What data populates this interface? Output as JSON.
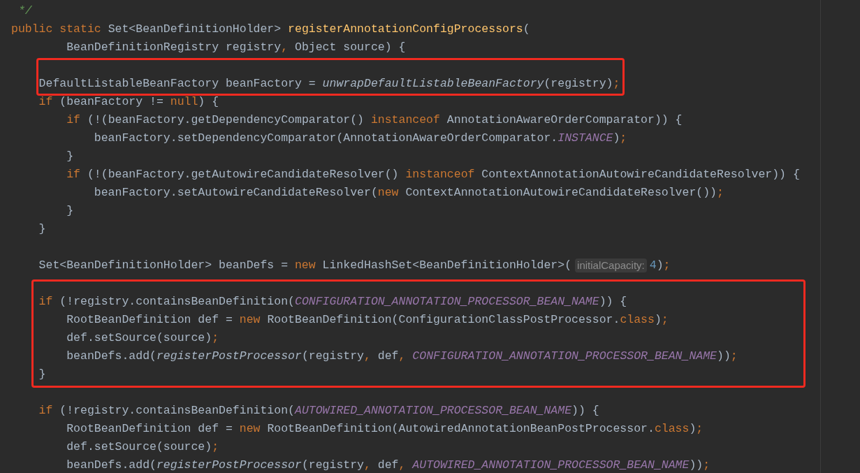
{
  "editor": {
    "blocks": [
      {
        "boxed": false,
        "lines": [
          {
            "kind": "code",
            "tokens": [
              {
                "kind": "comment",
                "text": " */"
              }
            ]
          },
          {
            "kind": "code",
            "tokens": [
              {
                "kind": "keyword",
                "text": "public static "
              },
              {
                "kind": "plain",
                "text": "Set<BeanDefinitionHolder> "
              },
              {
                "kind": "decl",
                "text": "registerAnnotationConfigProcessors"
              },
              {
                "kind": "plain",
                "text": "("
              }
            ]
          },
          {
            "kind": "code",
            "tokens": [
              {
                "kind": "plain",
                "text": "        BeanDefinitionRegistry registry"
              },
              {
                "kind": "keyword",
                "text": ","
              },
              {
                "kind": "plain",
                "text": " Object source) {"
              }
            ]
          }
        ]
      },
      {
        "boxed": true,
        "lines": [
          {
            "kind": "blank"
          },
          {
            "kind": "code",
            "tokens": [
              {
                "kind": "plain",
                "text": "    DefaultListableBeanFactory beanFactory = "
              },
              {
                "kind": "static",
                "text": "unwrapDefaultListableBeanFactory"
              },
              {
                "kind": "plain",
                "text": "(registry)"
              },
              {
                "kind": "keyword",
                "text": ";"
              }
            ]
          }
        ]
      },
      {
        "boxed": false,
        "lines": [
          {
            "kind": "code",
            "tokens": [
              {
                "kind": "keyword",
                "text": "    if"
              },
              {
                "kind": "plain",
                "text": " (beanFactory != "
              },
              {
                "kind": "keyword",
                "text": "null"
              },
              {
                "kind": "plain",
                "text": ") {"
              }
            ]
          },
          {
            "kind": "code",
            "tokens": [
              {
                "kind": "keyword",
                "text": "        if"
              },
              {
                "kind": "plain",
                "text": " (!(beanFactory.getDependencyComparator() "
              },
              {
                "kind": "keyword",
                "text": "instanceof"
              },
              {
                "kind": "plain",
                "text": " AnnotationAwareOrderComparator)) {"
              }
            ]
          },
          {
            "kind": "code",
            "tokens": [
              {
                "kind": "plain",
                "text": "            beanFactory.setDependencyComparator(AnnotationAwareOrderComparator."
              },
              {
                "kind": "constant",
                "text": "INSTANCE"
              },
              {
                "kind": "plain",
                "text": ")"
              },
              {
                "kind": "keyword",
                "text": ";"
              }
            ]
          },
          {
            "kind": "code",
            "tokens": [
              {
                "kind": "plain",
                "text": "        }"
              }
            ]
          },
          {
            "kind": "code",
            "tokens": [
              {
                "kind": "keyword",
                "text": "        if"
              },
              {
                "kind": "plain",
                "text": " (!(beanFactory.getAutowireCandidateResolver() "
              },
              {
                "kind": "keyword",
                "text": "instanceof"
              },
              {
                "kind": "plain",
                "text": " ContextAnnotationAutowireCandidateResolver)) {"
              }
            ]
          },
          {
            "kind": "code",
            "tokens": [
              {
                "kind": "plain",
                "text": "            beanFactory.setAutowireCandidateResolver("
              },
              {
                "kind": "keyword",
                "text": "new"
              },
              {
                "kind": "plain",
                "text": " ContextAnnotationAutowireCandidateResolver())"
              },
              {
                "kind": "keyword",
                "text": ";"
              }
            ]
          },
          {
            "kind": "code",
            "tokens": [
              {
                "kind": "plain",
                "text": "        }"
              }
            ]
          },
          {
            "kind": "code",
            "tokens": [
              {
                "kind": "plain",
                "text": "    }"
              }
            ]
          },
          {
            "kind": "blank"
          },
          {
            "kind": "code",
            "tokens": [
              {
                "kind": "plain",
                "text": "    Set<BeanDefinitionHolder> beanDefs = "
              },
              {
                "kind": "keyword",
                "text": "new"
              },
              {
                "kind": "plain",
                "text": " LinkedHashSet<BeanDefinitionHolder>("
              },
              {
                "kind": "hint",
                "text": "initialCapacity:"
              },
              {
                "kind": "number",
                "text": "4"
              },
              {
                "kind": "plain",
                "text": ")"
              },
              {
                "kind": "keyword",
                "text": ";"
              }
            ]
          }
        ]
      },
      {
        "boxed": true,
        "lines": [
          {
            "kind": "blank"
          },
          {
            "kind": "code",
            "tokens": [
              {
                "kind": "keyword",
                "text": "    if"
              },
              {
                "kind": "plain",
                "text": " (!registry.containsBeanDefinition("
              },
              {
                "kind": "constant",
                "text": "CONFIGURATION_ANNOTATION_PROCESSOR_BEAN_NAME"
              },
              {
                "kind": "plain",
                "text": ")) {"
              }
            ]
          },
          {
            "kind": "code",
            "tokens": [
              {
                "kind": "plain",
                "text": "        RootBeanDefinition def = "
              },
              {
                "kind": "keyword",
                "text": "new"
              },
              {
                "kind": "plain",
                "text": " RootBeanDefinition(ConfigurationClassPostProcessor."
              },
              {
                "kind": "keyword",
                "text": "class"
              },
              {
                "kind": "plain",
                "text": ")"
              },
              {
                "kind": "keyword",
                "text": ";"
              }
            ]
          },
          {
            "kind": "code",
            "tokens": [
              {
                "kind": "plain",
                "text": "        def.setSource(source)"
              },
              {
                "kind": "keyword",
                "text": ";"
              }
            ]
          },
          {
            "kind": "code",
            "tokens": [
              {
                "kind": "plain",
                "text": "        beanDefs.add("
              },
              {
                "kind": "static",
                "text": "registerPostProcessor"
              },
              {
                "kind": "plain",
                "text": "(registry"
              },
              {
                "kind": "keyword",
                "text": ","
              },
              {
                "kind": "plain",
                "text": " def"
              },
              {
                "kind": "keyword",
                "text": ", "
              },
              {
                "kind": "constant",
                "text": "CONFIGURATION_ANNOTATION_PROCESSOR_BEAN_NAME"
              },
              {
                "kind": "plain",
                "text": "))"
              },
              {
                "kind": "keyword",
                "text": ";"
              }
            ]
          },
          {
            "kind": "code",
            "tokens": [
              {
                "kind": "plain",
                "text": "    }"
              }
            ]
          }
        ]
      },
      {
        "boxed": false,
        "lines": [
          {
            "kind": "blank"
          },
          {
            "kind": "code",
            "tokens": [
              {
                "kind": "keyword",
                "text": "    if"
              },
              {
                "kind": "plain",
                "text": " (!registry.containsBeanDefinition("
              },
              {
                "kind": "constant",
                "text": "AUTOWIRED_ANNOTATION_PROCESSOR_BEAN_NAME"
              },
              {
                "kind": "plain",
                "text": ")) {"
              }
            ]
          },
          {
            "kind": "code",
            "tokens": [
              {
                "kind": "plain",
                "text": "        RootBeanDefinition def = "
              },
              {
                "kind": "keyword",
                "text": "new"
              },
              {
                "kind": "plain",
                "text": " RootBeanDefinition(AutowiredAnnotationBeanPostProcessor."
              },
              {
                "kind": "keyword",
                "text": "class"
              },
              {
                "kind": "plain",
                "text": ")"
              },
              {
                "kind": "keyword",
                "text": ";"
              }
            ]
          },
          {
            "kind": "code",
            "tokens": [
              {
                "kind": "plain",
                "text": "        def.setSource(source)"
              },
              {
                "kind": "keyword",
                "text": ";"
              }
            ]
          },
          {
            "kind": "code",
            "tokens": [
              {
                "kind": "plain",
                "text": "        beanDefs.add("
              },
              {
                "kind": "static",
                "text": "registerPostProcessor"
              },
              {
                "kind": "plain",
                "text": "(registry"
              },
              {
                "kind": "keyword",
                "text": ","
              },
              {
                "kind": "plain",
                "text": " def"
              },
              {
                "kind": "keyword",
                "text": ", "
              },
              {
                "kind": "constant",
                "text": "AUTOWIRED_ANNOTATION_PROCESSOR_BEAN_NAME"
              },
              {
                "kind": "plain",
                "text": "))"
              },
              {
                "kind": "keyword",
                "text": ";"
              }
            ]
          }
        ]
      }
    ]
  }
}
